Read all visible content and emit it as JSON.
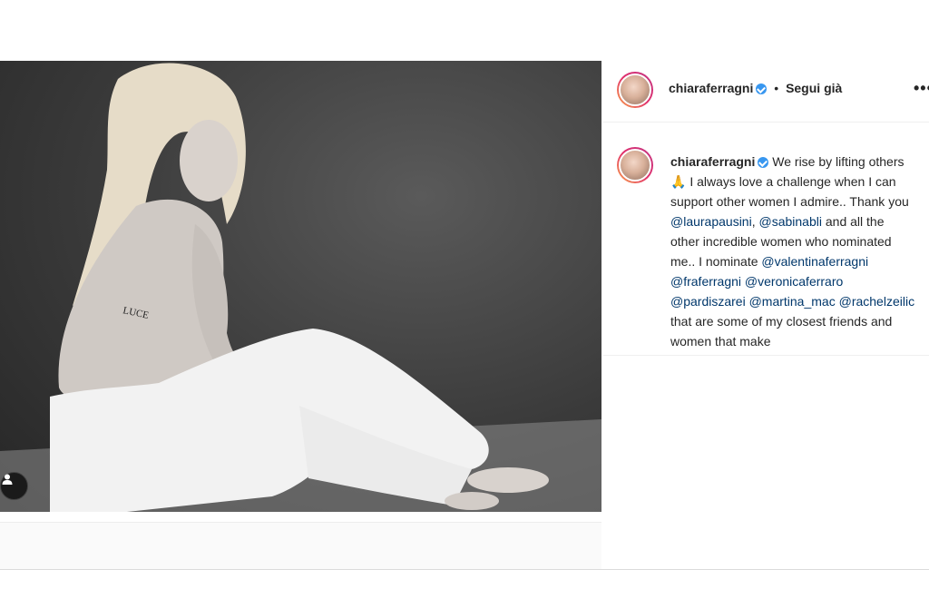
{
  "post": {
    "image_alt": "",
    "tattoo_text": "LUCE"
  },
  "header": {
    "username": "chiaraferragni",
    "separator": "•",
    "follow_state": "Segui già",
    "more_icon": "more-horizontal-icon"
  },
  "comment": {
    "username": "chiaraferragni",
    "text_1": "We rise by lifting others 🙏 I always love a challenge when I can support other women I admire.. Thank you ",
    "mention_1": "@laurapausini",
    "text_2": ", ",
    "mention_2": "@sabinabli",
    "text_3": " and all the other incredible women who nominated me.. I nominate ",
    "mention_3": "@valentinaferragni",
    "text_4": " ",
    "mention_4": "@fraferragni",
    "text_5": " ",
    "mention_5": "@veronicaferraro",
    "text_6": " ",
    "mention_6": "@pardiszarei",
    "text_7": " ",
    "mention_7": "@martina_mac",
    "text_8": " ",
    "mention_8": "@rachelzeilic",
    "text_9": " that are some of my closest friends and women that make"
  },
  "colors": {
    "accent": "#3897f0",
    "mention": "#00376b",
    "text": "#262626"
  }
}
